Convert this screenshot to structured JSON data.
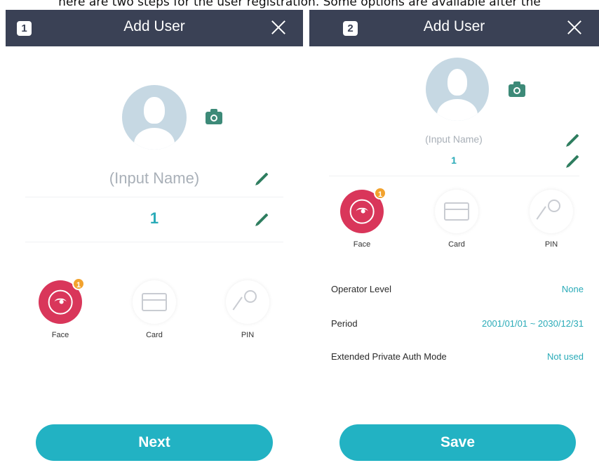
{
  "caption": "here are two steps for the user registration. Some options are available after the",
  "screen1": {
    "step": "1",
    "title": "Add User",
    "name_placeholder": "(Input Name)",
    "user_id": "1",
    "auth_modes": [
      {
        "label": "Face",
        "icon": "face-icon",
        "badge": "1"
      },
      {
        "label": "Card",
        "icon": "card-icon"
      },
      {
        "label": "PIN",
        "icon": "key-icon"
      }
    ],
    "next_label": "Next"
  },
  "screen2": {
    "step": "2",
    "title": "Add User",
    "name_placeholder": "(Input Name)",
    "user_id": "1",
    "auth_modes": [
      {
        "label": "Face",
        "icon": "face-icon",
        "badge": "1"
      },
      {
        "label": "Card",
        "icon": "card-icon"
      },
      {
        "label": "PIN",
        "icon": "key-icon"
      }
    ],
    "settings": [
      {
        "label": "Operator Level",
        "value": "None"
      },
      {
        "label": "Period",
        "value": "2001/01/01 ~ 2030/12/31"
      },
      {
        "label": "Extended Private Auth Mode",
        "value": "Not used"
      }
    ],
    "save_label": "Save"
  },
  "colors": {
    "header": "#3a4155",
    "accent": "#22b2c3",
    "face": "#d9365a",
    "badge": "#f2a22d",
    "edit": "#2e7d5f"
  }
}
